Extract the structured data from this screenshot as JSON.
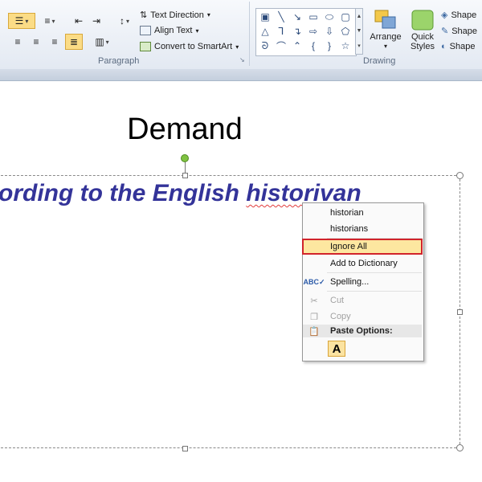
{
  "ribbon": {
    "paragraph_group_label": "Paragraph",
    "drawing_group_label": "Drawing",
    "text_direction_label": "Text Direction",
    "align_text_label": "Align Text",
    "convert_smartart_label": "Convert to SmartArt",
    "arrange_label": "Arrange",
    "quick_styles_label": "Quick Styles",
    "shape_fill_label": "Shape",
    "shape_outline_label": "Shape",
    "shape_effects_label": "Shape"
  },
  "slide": {
    "title": "Demand",
    "body_prefix": "ording to the English ",
    "body_misspelled": "historivan"
  },
  "context_menu": {
    "suggestions": [
      "historian",
      "historians"
    ],
    "ignore_all": "Ignore All",
    "add_to_dictionary": "Add to Dictionary",
    "spelling": "Spelling...",
    "cut": "Cut",
    "copy": "Copy",
    "paste_options": "Paste Options:",
    "paste_keep_text_only": "A"
  },
  "colors": {
    "body_text": "#333399",
    "highlight_border": "#d1242b",
    "highlight_fill": "#fde7a0"
  }
}
